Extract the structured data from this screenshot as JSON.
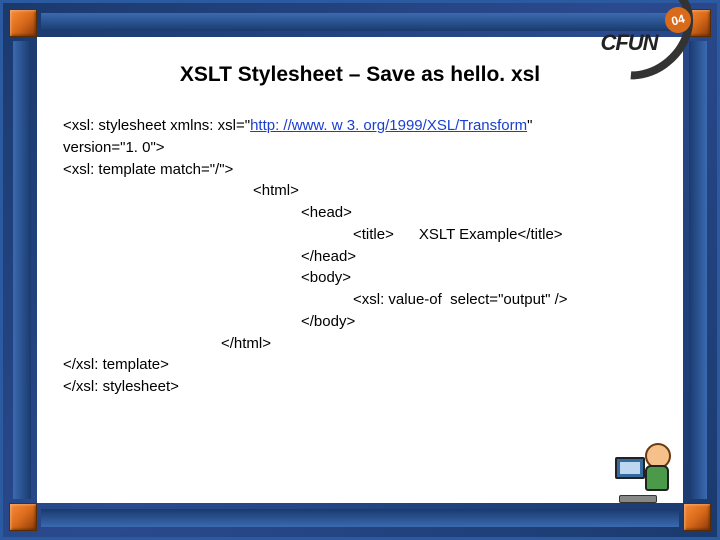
{
  "logo": {
    "text": "CFUN",
    "badge": "04"
  },
  "title": "XSLT Stylesheet – Save as hello. xsl",
  "code": {
    "l1a": "<xsl: stylesheet xmlns: xsl=\"",
    "l1link": "http: //www. w 3. org/1999/XSL/Transform",
    "l1b": "\"",
    "l2": "version=\"1. 0\">",
    "l3": "<xsl: template match=\"/\">",
    "l4": "<html>",
    "l5": "<head>",
    "l6": "<title>      XSLT Example</title>",
    "l7": "</head>",
    "l8": "<body>",
    "l9": "<xsl: value-of  select=\"output\" />",
    "l10": "</body>",
    "l11": "</html>",
    "l12": "</xsl: template>",
    "l13": "</xsl: stylesheet>"
  }
}
